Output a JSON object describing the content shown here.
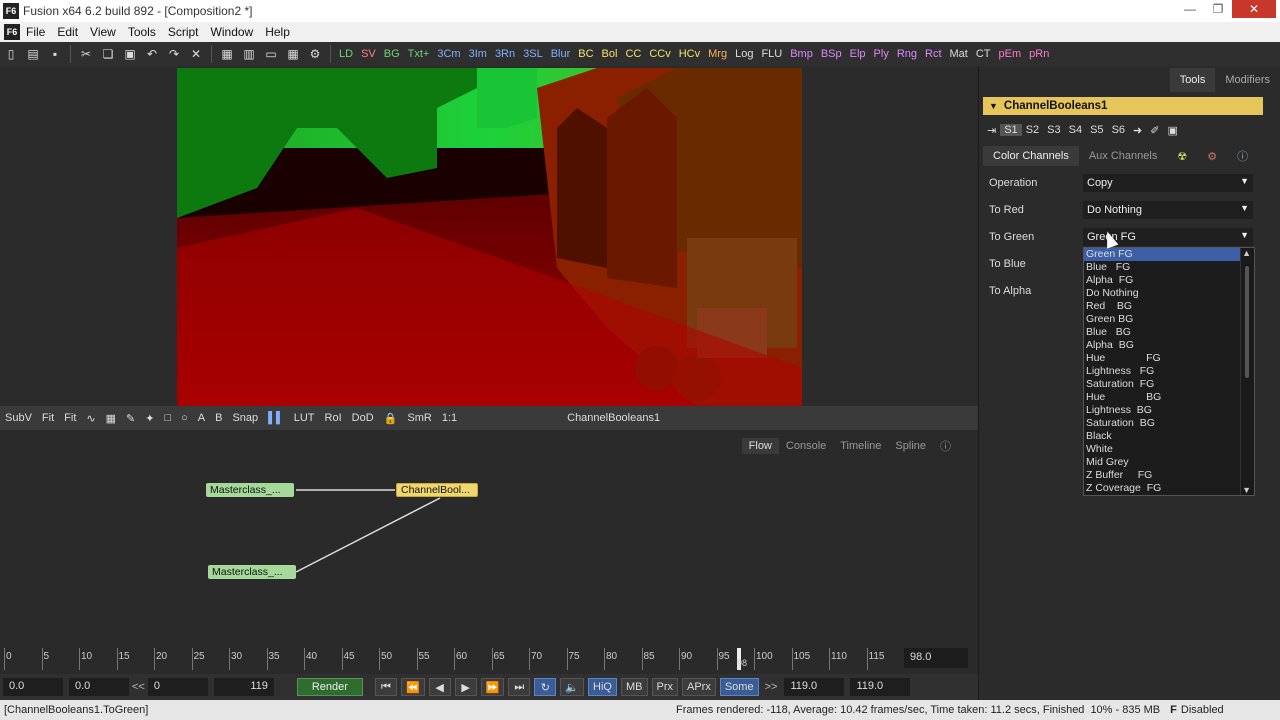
{
  "window": {
    "title": "Fusion x64 6.2 build 892 - [Composition2 *]",
    "app_icon": "F6"
  },
  "menu": [
    "File",
    "Edit",
    "View",
    "Tools",
    "Script",
    "Window",
    "Help"
  ],
  "toolbar_tools": [
    {
      "label": "LD",
      "color": "#6fd36f"
    },
    {
      "label": "SV",
      "color": "#ff8080"
    },
    {
      "label": "BG",
      "color": "#6fd36f"
    },
    {
      "label": "Txt+",
      "color": "#6fd36f"
    },
    {
      "label": "3Cm",
      "color": "#80b0ff"
    },
    {
      "label": "3Im",
      "color": "#80b0ff"
    },
    {
      "label": "3Rn",
      "color": "#80b0ff"
    },
    {
      "label": "3SL",
      "color": "#80b0ff"
    },
    {
      "label": "Blur",
      "color": "#80b0ff"
    },
    {
      "label": "BC",
      "color": "#f3e36c"
    },
    {
      "label": "Bol",
      "color": "#f3e36c"
    },
    {
      "label": "CC",
      "color": "#f3e36c"
    },
    {
      "label": "CCv",
      "color": "#f3e36c"
    },
    {
      "label": "HCv",
      "color": "#f3e36c"
    },
    {
      "label": "Mrg",
      "color": "#ffb15a"
    },
    {
      "label": "Log",
      "color": "#ddd"
    },
    {
      "label": "FLU",
      "color": "#ddd"
    },
    {
      "label": "Bmp",
      "color": "#e088ff"
    },
    {
      "label": "BSp",
      "color": "#e088ff"
    },
    {
      "label": "Elp",
      "color": "#e088ff"
    },
    {
      "label": "Ply",
      "color": "#e088ff"
    },
    {
      "label": "Rng",
      "color": "#e088ff"
    },
    {
      "label": "Rct",
      "color": "#e088ff"
    },
    {
      "label": "Mat",
      "color": "#ddd"
    },
    {
      "label": "CT",
      "color": "#ddd"
    },
    {
      "label": "pEm",
      "color": "#ff7ad0"
    },
    {
      "label": "pRn",
      "color": "#ff7ad0"
    }
  ],
  "viewer_bar": {
    "subv": "SubV",
    "fit1": "Fit",
    "fit2": "Fit",
    "snap": "Snap",
    "lut": "LUT",
    "roi": "RoI",
    "dod": "DoD",
    "smr": "SmR",
    "one": "1:1",
    "viewer_name": "ChannelBooleans1",
    "letters": [
      "A",
      "B"
    ]
  },
  "flow_tabs": [
    "Flow",
    "Console",
    "Timeline",
    "Spline"
  ],
  "nodes": {
    "loader1": "Masterclass_...",
    "loader2": "Masterclass_...",
    "channel": "ChannelBool..."
  },
  "ruler_labels": [
    "0",
    "5",
    "10",
    "15",
    "20",
    "25",
    "30",
    "35",
    "40",
    "45",
    "50",
    "55",
    "60",
    "65",
    "70",
    "75",
    "80",
    "85",
    "90",
    "95",
    "100",
    "105",
    "110",
    "115"
  ],
  "ruler_current": "98",
  "timeline_value": "98.0",
  "transport": {
    "start": "0.0",
    "global_start": "0.0",
    "arrows_left": "<<",
    "range_start": "0",
    "range_end": "119",
    "render": "Render",
    "hiq": "HiQ",
    "mb": "MB",
    "prx": "Prx",
    "aprx": "APrx",
    "some": "Some",
    "arrows_right": ">>",
    "end": "119.0",
    "global_end": "119.0"
  },
  "status": {
    "left": "[ChannelBooleans1.ToGreen]",
    "frames": "Frames rendered: -118,  Average: 10.42 frames/sec,  Time taken: 11.2 secs,  Finished",
    "mem": "10% - 835 MB",
    "disabled": "Disabled"
  },
  "panel": {
    "tabs": [
      "Tools",
      "Modifiers"
    ],
    "tool_name": "ChannelBooleans1",
    "slots": [
      "S1",
      "S2",
      "S3",
      "S4",
      "S5",
      "S6"
    ],
    "channel_tabs": [
      "Color Channels",
      "Aux Channels"
    ],
    "fields": [
      {
        "label": "Operation",
        "value": "Copy"
      },
      {
        "label": "To Red",
        "value": "Do Nothing"
      },
      {
        "label": "To Green",
        "value": "Green FG"
      },
      {
        "label": "To Blue",
        "value": ""
      },
      {
        "label": "To Alpha",
        "value": ""
      }
    ],
    "dropdown_options": [
      "Green FG",
      "Blue   FG",
      "Alpha  FG",
      "Do Nothing",
      "Red    BG",
      "Green BG",
      "Blue   BG",
      "Alpha  BG",
      "Hue              FG",
      "Lightness   FG",
      "Saturation  FG",
      "Hue              BG",
      "Lightness  BG",
      "Saturation  BG",
      "Black",
      "White",
      "Mid Grey",
      "Z Buffer     FG",
      "Z Coverage  FG"
    ],
    "dropdown_selected": "Green FG"
  }
}
